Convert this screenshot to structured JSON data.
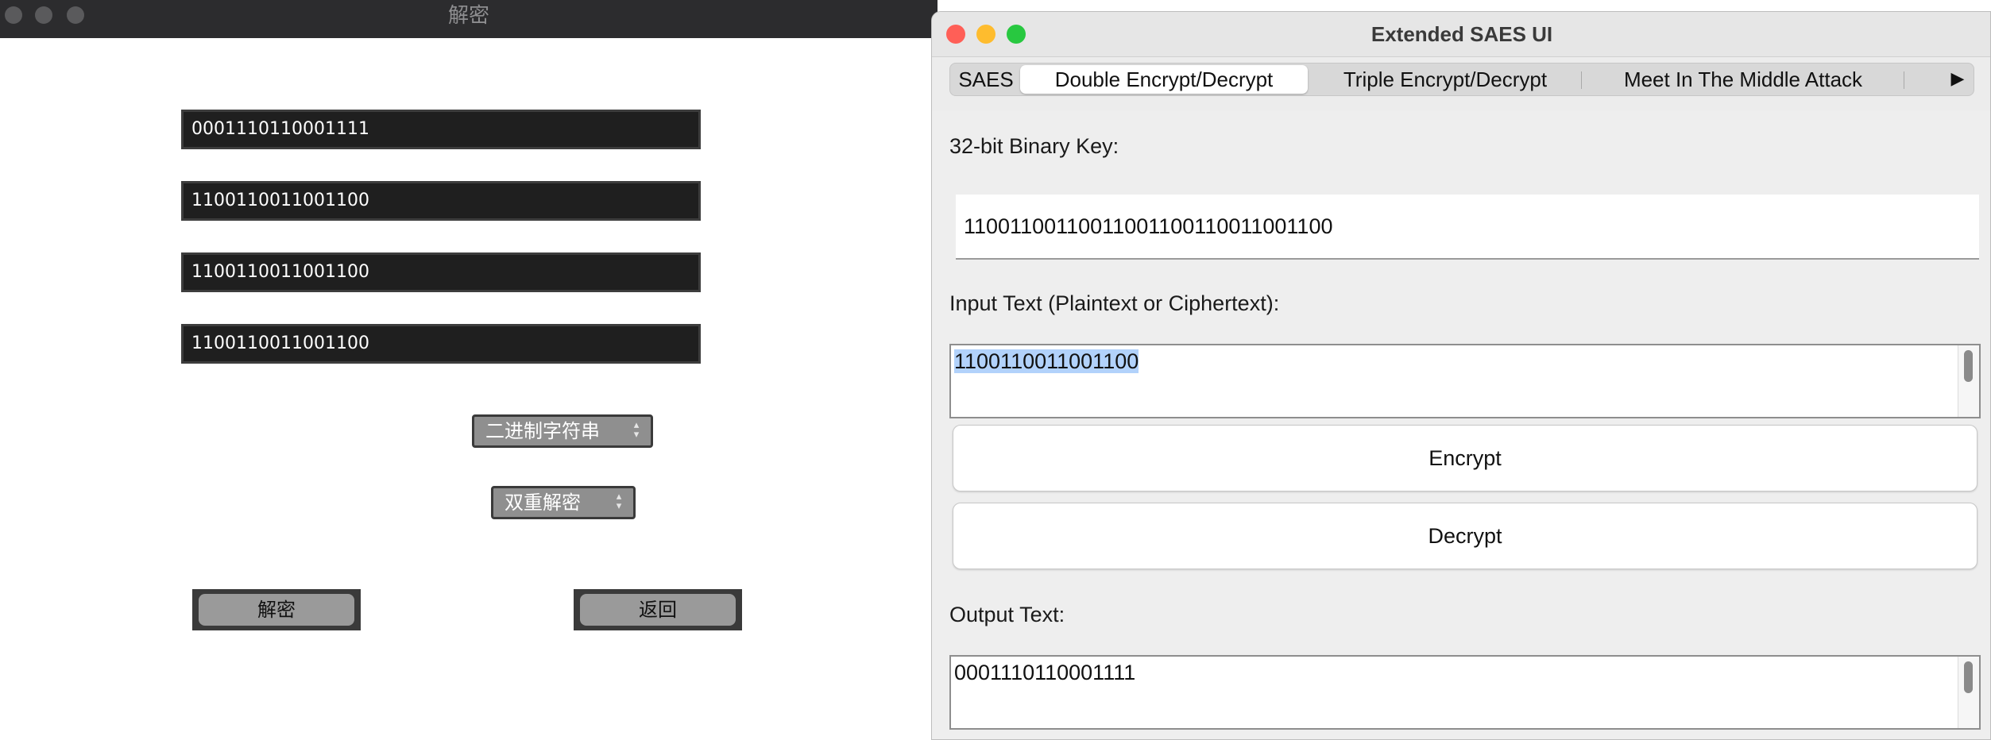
{
  "left_window": {
    "title": "解密",
    "fields": [
      "0001110110001111",
      "1100110011001100",
      "1100110011001100",
      "1100110011001100"
    ],
    "format_select": "二进制字符串",
    "mode_select": "双重解密",
    "decrypt_button": "解密",
    "back_button": "返回"
  },
  "right_window": {
    "title": "Extended SAES UI",
    "tabs": [
      "SAES",
      "Double Encrypt/Decrypt",
      "Triple Encrypt/Decrypt",
      "Meet In The Middle Attack"
    ],
    "active_tab": "Double Encrypt/Decrypt",
    "tab_scroll_icon": "▶",
    "key_label": "32-bit Binary Key:",
    "key_value": "11001100110011001100110011001100",
    "input_label": "Input Text (Plaintext or Ciphertext):",
    "input_value": "1100110011001100",
    "encrypt_button": "Encrypt",
    "decrypt_button": "Decrypt",
    "output_label": "Output Text:",
    "output_value": "0001110110001111"
  },
  "colors": {
    "close": "#ff5f57",
    "minimize": "#febc2e",
    "zoom": "#28c840",
    "dark_field": "#1f1f1f",
    "selection": "#b2d2fb"
  }
}
